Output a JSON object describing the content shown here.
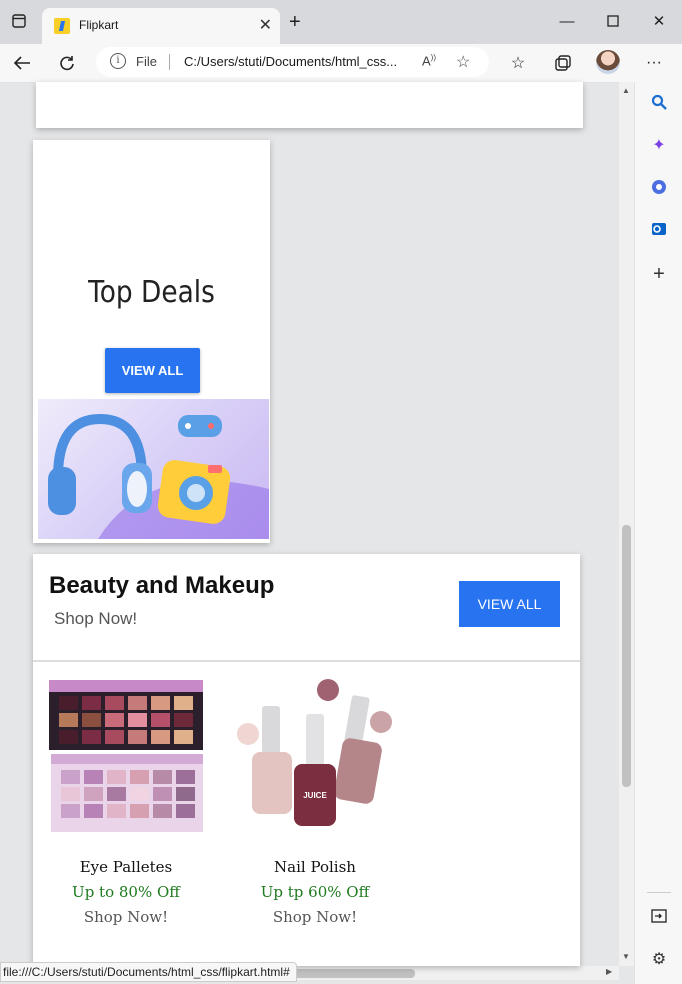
{
  "browser": {
    "tab_title": "Flipkart",
    "address_scheme": "File",
    "address_url": "C:/Users/stuti/Documents/html_css...",
    "status_url": "file:///C:/Users/stuti/Documents/html_css/flipkart.html#"
  },
  "deals": {
    "title": "Top Deals",
    "button_label": "VIEW ALL"
  },
  "beauty": {
    "title": "Beauty and Makeup",
    "subtitle": "Shop Now!",
    "button_label": "VIEW ALL",
    "products": [
      {
        "name": "Eye Palletes",
        "offer": "Up to 80% Off",
        "cta": "Shop Now!"
      },
      {
        "name": "Nail Polish",
        "offer": "Up tp 60% Off",
        "cta": "Shop Now!"
      }
    ]
  },
  "colors": {
    "accent": "#2874f0",
    "offer_green": "#1e7a1e"
  }
}
